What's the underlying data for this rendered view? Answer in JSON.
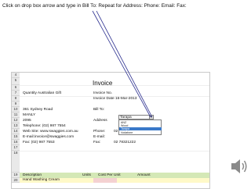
{
  "instruction": "Click on drop box arrow and type in Bill To:  Repeat for Address: Phone: Email: Fax:",
  "sheet": {
    "invoice_title": "Invoice",
    "rows": [
      "4",
      "5",
      "6",
      "7",
      "8",
      "9",
      "10",
      "11",
      "12",
      "13",
      "14",
      "15",
      "16",
      "17",
      "18",
      "19",
      "20"
    ],
    "company": "Quantity Australian Gift",
    "address_line1": "361 Sydney Road",
    "address_line2": "MANLY",
    "address_line3": "2095",
    "telephone": "Telephone: (02) 987 7554",
    "website": "Web Site: www.swaggies.com.au",
    "email": "E-mail:invoice@swaggies.com",
    "fax": "Fax: (02) 987 7553",
    "invoice_no_label": "Invoice No.",
    "invoice_date": "Invoice Date 16-Mar-2013",
    "bill_to_label": "Bill To:",
    "bill_to_value": "Tarapa",
    "address_label": "Address",
    "phone_label": "Phone:",
    "phone_value": "02 78321222",
    "email_label": "E-mail:",
    "fax_label": "Fax:",
    "fax_value": "02 78321222",
    "col_description": "Description",
    "col_units": "Units",
    "col_cost_per_unit": "Cost Per Unit",
    "col_amount": "Amount",
    "first_item": "Hand Washing Cream"
  },
  "dropdown": {
    "items": [
      "ANZ",
      "Wood",
      "Tarapa",
      "Vodafone"
    ],
    "selected_index": 2
  },
  "colors": {
    "header_band": "#d4e8b6",
    "item_band": "#fff9c8",
    "selection": "#3a79c9"
  }
}
